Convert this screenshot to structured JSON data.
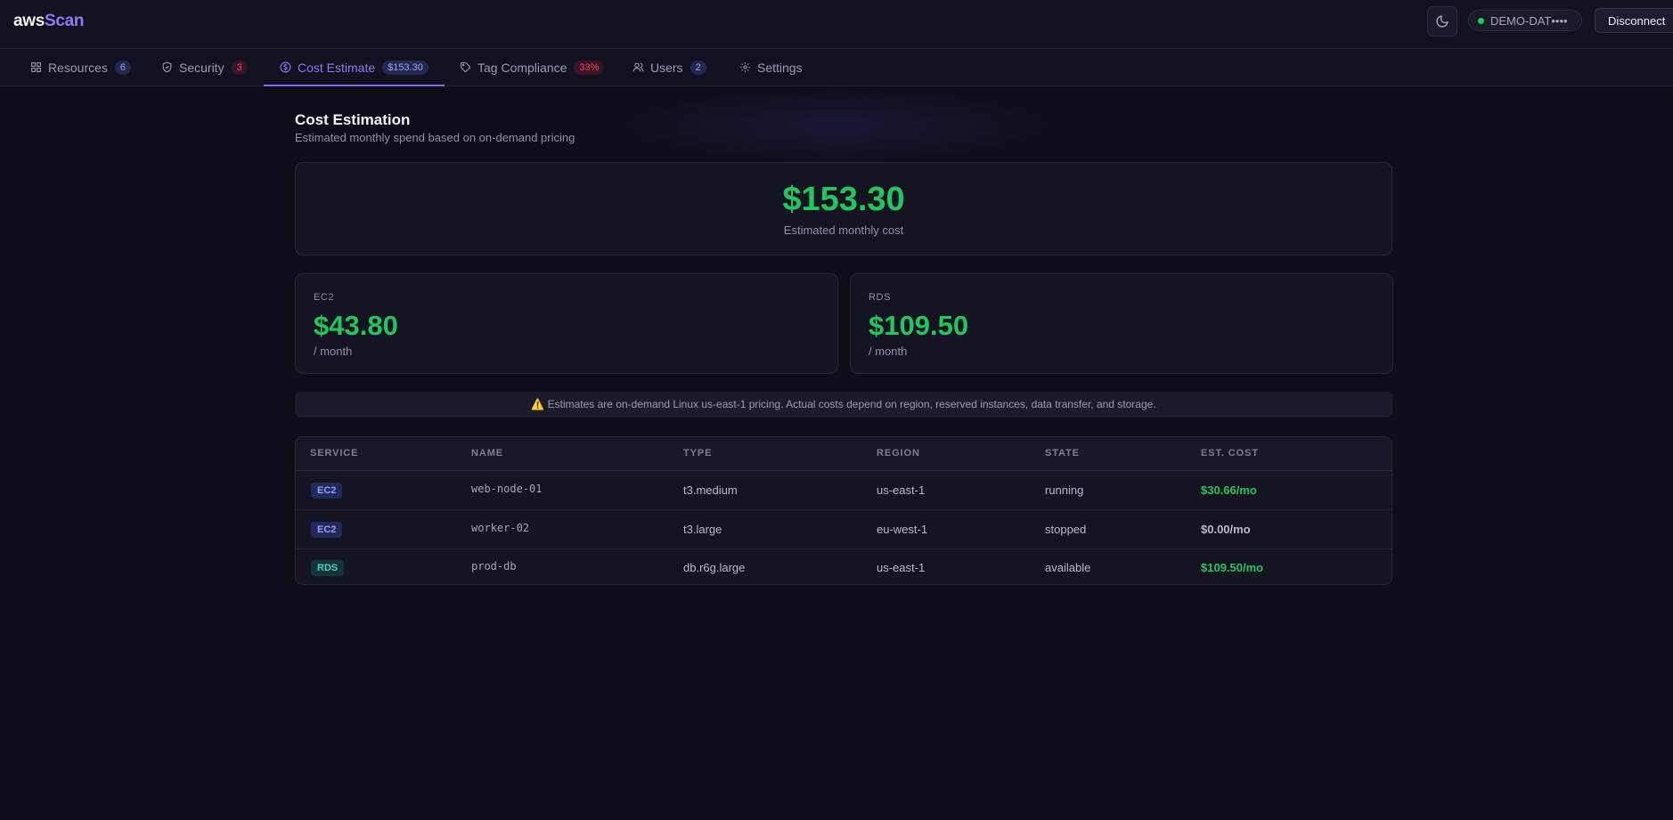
{
  "app": {
    "logo_prefix": "aws",
    "logo_suffix": "Scan"
  },
  "header": {
    "connection_label": "DEMO-DAT••••",
    "connection_status_color": "#22c55e",
    "disconnect_label": "Disconnect"
  },
  "tabs": [
    {
      "label": "Resources",
      "badge": "6",
      "icon": "grid-icon"
    },
    {
      "label": "Security",
      "badge": "3",
      "icon": "shield-icon"
    },
    {
      "label": "Cost Estimate",
      "badge": "$153.30",
      "icon": "dollar-icon",
      "active": true
    },
    {
      "label": "Tag Compliance",
      "badge": "33%",
      "icon": "tag-icon"
    },
    {
      "label": "Users",
      "badge": "2",
      "icon": "users-icon"
    },
    {
      "label": "Settings",
      "badge": "",
      "icon": "gear-icon"
    }
  ],
  "page": {
    "title": "Cost Estimation",
    "subtitle": "Estimated monthly spend based on on-demand pricing"
  },
  "total": {
    "value": "$153.30",
    "label": "Estimated monthly cost"
  },
  "services": [
    {
      "label": "EC2",
      "value": "$43.80",
      "period": "/ month"
    },
    {
      "label": "RDS",
      "value": "$109.50",
      "period": "/ month"
    }
  ],
  "notice": "⚠️ Estimates are on-demand Linux us-east-1 pricing. Actual costs depend on region, reserved instances, data transfer, and storage.",
  "table": {
    "headers": [
      "SERVICE",
      "NAME",
      "TYPE",
      "REGION",
      "STATE",
      "EST. COST"
    ],
    "rows": [
      {
        "service": "EC2",
        "name": "web-node-01",
        "type": "t3.medium",
        "region": "us-east-1",
        "state": "running",
        "cost": "$30.66/mo"
      },
      {
        "service": "EC2",
        "name": "worker-02",
        "type": "t3.large",
        "region": "eu-west-1",
        "state": "stopped",
        "cost": "$0.00/mo"
      },
      {
        "service": "RDS",
        "name": "prod-db",
        "type": "db.r6g.large",
        "region": "us-east-1",
        "state": "available",
        "cost": "$109.50/mo"
      }
    ]
  },
  "colors": {
    "accent": "#8b7cf6",
    "money": "#22c55e",
    "danger": "#f0445e"
  }
}
